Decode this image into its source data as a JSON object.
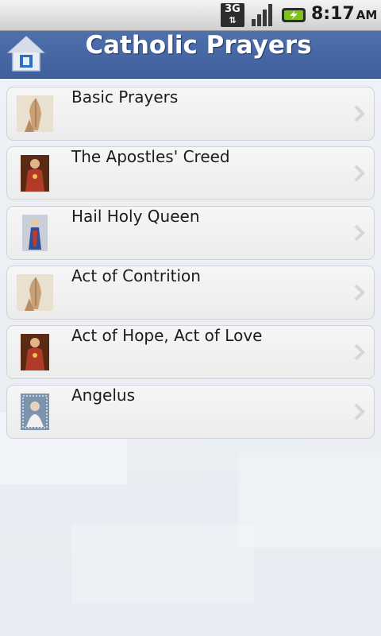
{
  "status_bar": {
    "network": "3G",
    "time": "8:17",
    "ampm": "AM",
    "icons": [
      "3g-network-icon",
      "signal-strength-icon",
      "battery-charging-icon"
    ]
  },
  "header": {
    "title": "Catholic Prayers",
    "home_icon": "home-icon",
    "bg_color": "#4565a3"
  },
  "prayers": [
    {
      "label": "Basic Prayers",
      "icon": "praying-hands-icon"
    },
    {
      "label": "The Apostles' Creed",
      "icon": "sacred-heart-icon"
    },
    {
      "label": "Hail Holy Queen",
      "icon": "virgin-mary-icon"
    },
    {
      "label": "Act of Contrition",
      "icon": "praying-hands-icon"
    },
    {
      "label": "Act of Hope, Act of Love",
      "icon": "sacred-heart-icon"
    },
    {
      "label": "Angelus",
      "icon": "angelus-icon"
    }
  ]
}
